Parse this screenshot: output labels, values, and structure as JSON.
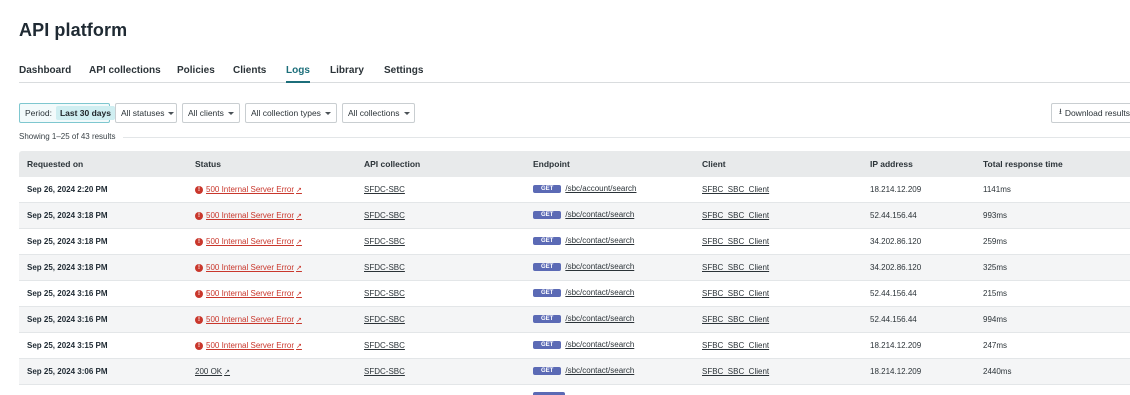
{
  "page": {
    "title": "API platform"
  },
  "tabs": [
    "Dashboard",
    "API collections",
    "Policies",
    "Clients",
    "Logs",
    "Library",
    "Settings"
  ],
  "active_tab": "Logs",
  "filters": {
    "period_label": "Period:",
    "period_value": "Last 30 days",
    "statuses": "All statuses",
    "clients": "All clients",
    "collection_types": "All collection types",
    "collections": "All collections"
  },
  "download": {
    "label": "Download results",
    "icon": "download-icon"
  },
  "showing": "Showing 1–25 of 43 results",
  "table": {
    "columns": [
      "Requested on",
      "Status",
      "API collection",
      "Endpoint",
      "Client",
      "IP address",
      "Total response time"
    ],
    "rows": [
      {
        "requested_on": "Sep 26, 2024 2:20 PM",
        "status": "500 Internal Server Error",
        "status_type": "error",
        "collection": "SFDC-SBC",
        "method": "GET",
        "endpoint": "/sbc/account/search",
        "client": "SFBC_SBC_Client",
        "ip": "18.214.12.209",
        "time": "1141ms"
      },
      {
        "requested_on": "Sep 25, 2024 3:18 PM",
        "status": "500 Internal Server Error",
        "status_type": "error",
        "collection": "SFDC-SBC",
        "method": "GET",
        "endpoint": "/sbc/contact/search",
        "client": "SFBC_SBC_Client",
        "ip": "52.44.156.44",
        "time": "993ms"
      },
      {
        "requested_on": "Sep 25, 2024 3:18 PM",
        "status": "500 Internal Server Error",
        "status_type": "error",
        "collection": "SFDC-SBC",
        "method": "GET",
        "endpoint": "/sbc/contact/search",
        "client": "SFBC_SBC_Client",
        "ip": "34.202.86.120",
        "time": "259ms"
      },
      {
        "requested_on": "Sep 25, 2024 3:18 PM",
        "status": "500 Internal Server Error",
        "status_type": "error",
        "collection": "SFDC-SBC",
        "method": "GET",
        "endpoint": "/sbc/contact/search",
        "client": "SFBC_SBC_Client",
        "ip": "34.202.86.120",
        "time": "325ms"
      },
      {
        "requested_on": "Sep 25, 2024 3:16 PM",
        "status": "500 Internal Server Error",
        "status_type": "error",
        "collection": "SFDC-SBC",
        "method": "GET",
        "endpoint": "/sbc/contact/search",
        "client": "SFBC_SBC_Client",
        "ip": "52.44.156.44",
        "time": "215ms"
      },
      {
        "requested_on": "Sep 25, 2024 3:16 PM",
        "status": "500 Internal Server Error",
        "status_type": "error",
        "collection": "SFDC-SBC",
        "method": "GET",
        "endpoint": "/sbc/contact/search",
        "client": "SFBC_SBC_Client",
        "ip": "52.44.156.44",
        "time": "994ms"
      },
      {
        "requested_on": "Sep 25, 2024 3:15 PM",
        "status": "500 Internal Server Error",
        "status_type": "error",
        "collection": "SFDC-SBC",
        "method": "GET",
        "endpoint": "/sbc/contact/search",
        "client": "SFBC_SBC_Client",
        "ip": "18.214.12.209",
        "time": "247ms"
      },
      {
        "requested_on": "Sep 25, 2024 3:06 PM",
        "status": "200 OK",
        "status_type": "ok",
        "collection": "SFDC-SBC",
        "method": "GET",
        "endpoint": "/sbc/contact/search",
        "client": "SFBC_SBC_Client",
        "ip": "18.214.12.209",
        "time": "2440ms"
      }
    ]
  },
  "colors": {
    "accent": "#1c6e7a",
    "error": "#c9372c",
    "method_badge": "#5b6ab5",
    "header_bg": "#e8eaeb"
  }
}
